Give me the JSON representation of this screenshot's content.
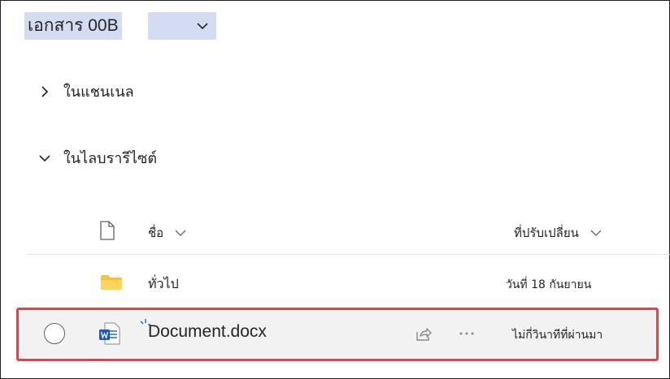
{
  "library": {
    "title": "เอกสาร 00B",
    "title_highlight_color": "#d4dcf3"
  },
  "sections": [
    {
      "label": "ในแชนเนล",
      "state": "collapsed",
      "icon": "chevron-right-icon"
    },
    {
      "label": "ในไลบรารีไซต์",
      "state": "expanded",
      "icon": "chevron-down-icon"
    }
  ],
  "columns": {
    "type_icon": "file-icon",
    "name": "ชื่อ",
    "modified": "ที่ปรับเปลี่ยน"
  },
  "rows": [
    {
      "type": "folder",
      "icon": "folder-icon",
      "name": "ทั่วไป",
      "modified": "วันที่ 18 กันยายน"
    },
    {
      "type": "docx",
      "icon": "word-file-icon",
      "name": "Document.docx",
      "modified": "ไม่กี่วินาทีที่ผ่านมา",
      "is_new": true
    }
  ],
  "colors": {
    "highlight_border": "#d9474a",
    "selected_row_bg": "#f2f2f2",
    "folder": "#f7c13b",
    "word_blue": "#185abd",
    "new_indicator": "#0f6cbd"
  }
}
